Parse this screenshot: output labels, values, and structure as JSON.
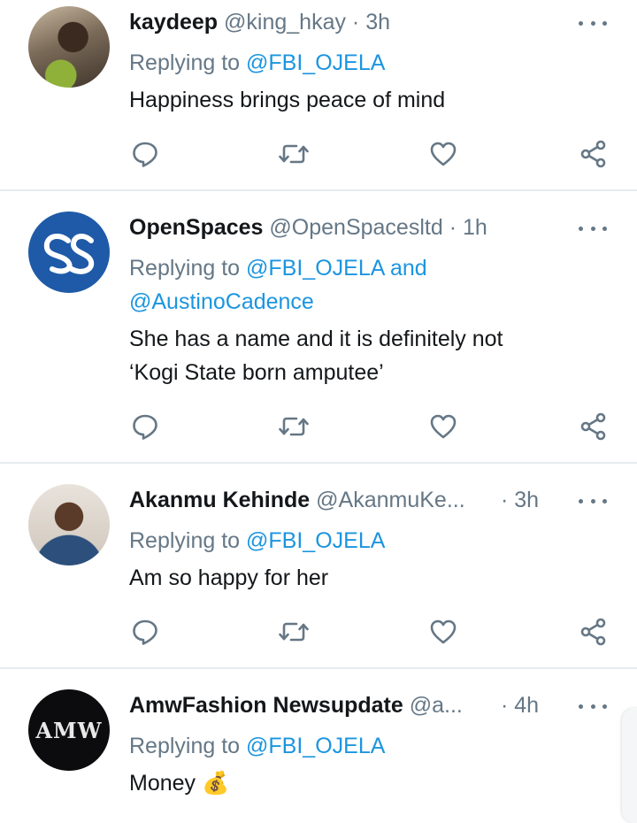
{
  "tweets": [
    {
      "name": "kaydeep",
      "handle": "@king_hkay",
      "time": "· 3h",
      "replying_label": "Replying to",
      "mentions": "@FBI_OJELA",
      "mentions_line2": "",
      "text_line1": "Happiness brings peace of mind",
      "text_line2": "",
      "avatar": "profile-photo"
    },
    {
      "name": "OpenSpaces",
      "handle": "@OpenSpacesltd",
      "time": "· 1h",
      "replying_label": "Replying to",
      "mentions": "@FBI_OJELA and",
      "mentions_line2": "@AustinoCadence",
      "text_line1": "She has a name and it is definitely  not",
      "text_line2": "‘Kogi State born amputee’",
      "avatar": "openspaces-logo"
    },
    {
      "name": "Akanmu Kehinde",
      "handle": "@AkanmuKe...",
      "time": "· 3h",
      "replying_label": "Replying to",
      "mentions": "@FBI_OJELA",
      "mentions_line2": "",
      "text_line1": "Am so happy for her",
      "text_line2": "",
      "avatar": "profile-photo"
    },
    {
      "name": "AmwFashion Newsupdate",
      "handle": "@a...",
      "time": "· 4h",
      "replying_label": "Replying to",
      "mentions": "@FBI_OJELA",
      "mentions_line2": "",
      "text_line1": "Money",
      "text_line2": "",
      "emoji": "💰",
      "avatar": "amw-logo",
      "avatar_text": "AMW"
    }
  ],
  "icons": {
    "reply": "reply-icon",
    "retweet": "retweet-icon",
    "like": "heart-icon",
    "share": "share-icon",
    "more": "more-dots-icon"
  },
  "colors": {
    "link": "#1b95e0",
    "secondary": "#657786",
    "primary": "#14171a",
    "divider": "#e6ecf0",
    "openspaces_blue": "#1e5aa8"
  }
}
